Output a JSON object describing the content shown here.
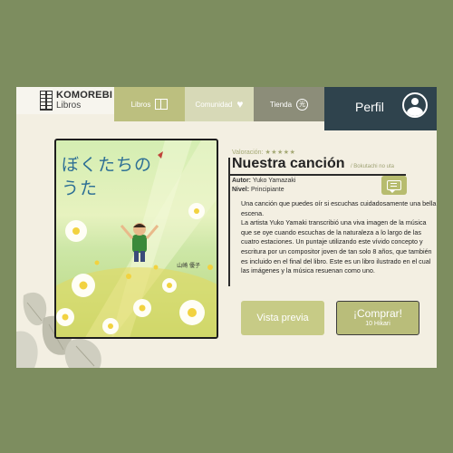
{
  "brand": {
    "name": "KOMOREBI",
    "subtitle": "Libros"
  },
  "nav": {
    "libros": "Libros",
    "comunidad": "Comunidad",
    "tienda": "Tienda",
    "tienda_icon_glyph": "光",
    "perfil": "Perfil"
  },
  "book": {
    "cover_title_line1": "ぼくたちの",
    "cover_title_line2": "うた",
    "cover_author": "山崎 優子",
    "rating_label": "Valoración:",
    "rating_stars": "★★★★★",
    "rating": 5,
    "title": "Nuestra canción",
    "romaji": "/ Bokutachi no uta",
    "author_label": "Autor:",
    "author": "Yuko Yamazaki",
    "level_label": "Nivel:",
    "level": "Principiante",
    "description_1": "Una canción que puedes oír si escuchas cuidadosamente una bella escena.",
    "description_2": "La artista Yuko Yamaki transcribió una viva imagen de la música que se oye cuando escuchas de la naturaleza a lo largo de las cuatro estaciones. Un puntaje utilizando este vívido concepto y escritura por un compositor joven de tan solo 8 años, que también es incluido en el final del libro. Este es un libro ilustrado en el cual las imágenes y la música resuenan como uno."
  },
  "actions": {
    "preview": "Vista previa",
    "buy": "¡Comprar!",
    "price": "10 Hikari"
  },
  "colors": {
    "background": "#7d8d5f",
    "panel": "#f3efe2",
    "accent": "#bcbf7f",
    "perfil": "#2f434d"
  }
}
